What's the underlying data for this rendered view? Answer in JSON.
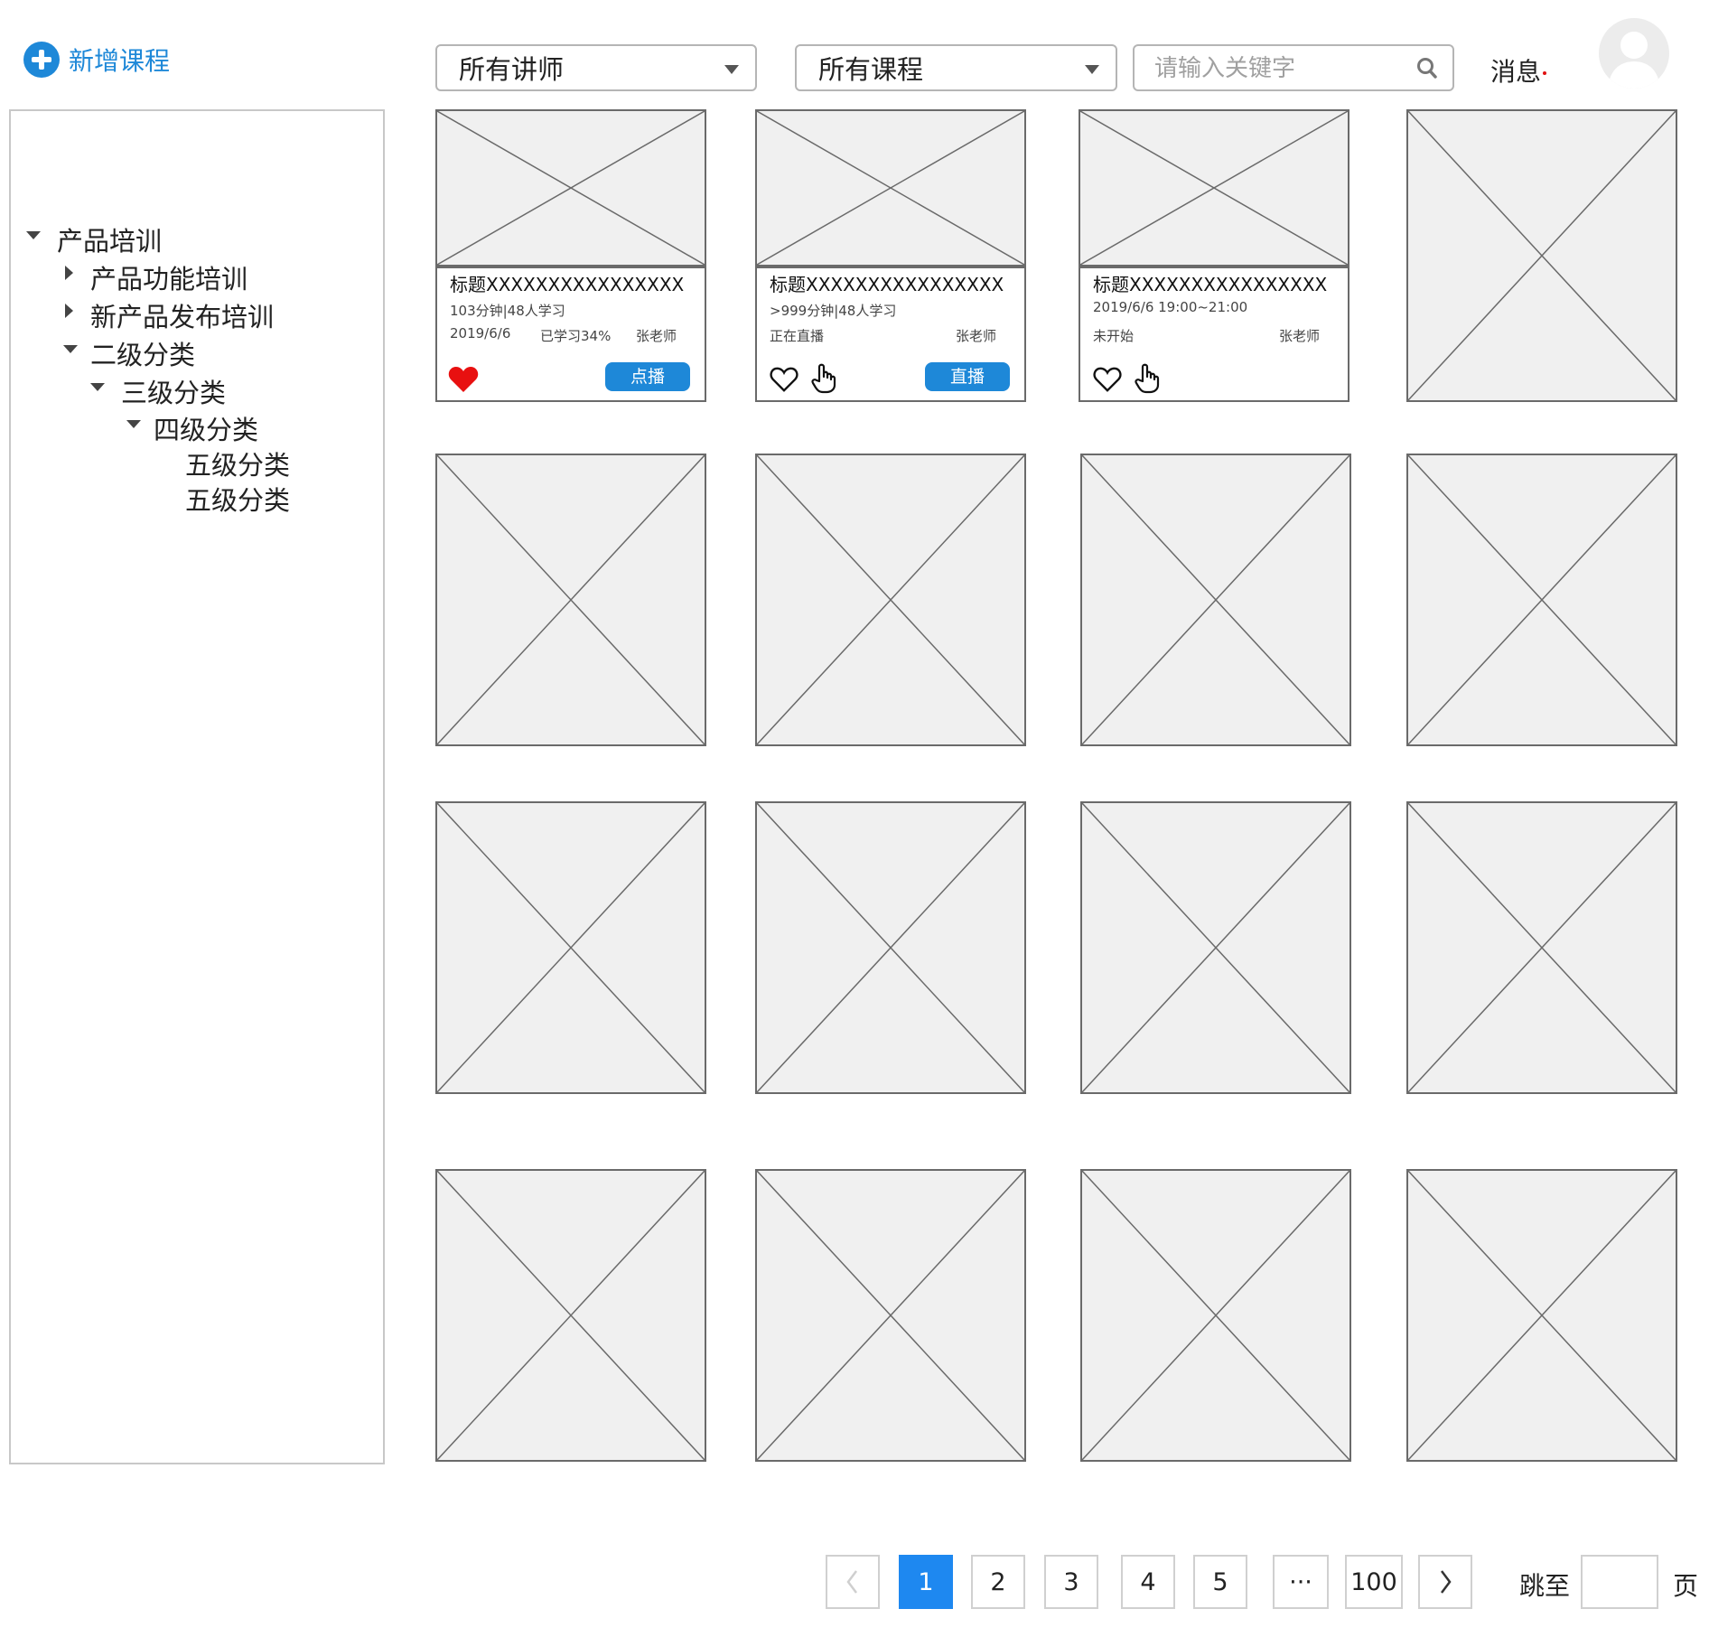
{
  "header": {
    "add_course_label": "新增课程",
    "teacher_select": "所有讲师",
    "course_select": "所有课程",
    "search_placeholder": "请输入关键字",
    "messages_label": "消息"
  },
  "sidebar": {
    "items": [
      {
        "label": "产品培训",
        "expanded": true
      },
      {
        "label": "产品功能培训",
        "expanded": false
      },
      {
        "label": "新产品发布培训",
        "expanded": false
      },
      {
        "label": "二级分类",
        "expanded": true
      },
      {
        "label": "三级分类",
        "expanded": true
      },
      {
        "label": "四级分类",
        "expanded": true
      },
      {
        "label": "五级分类"
      },
      {
        "label": "五级分类"
      }
    ]
  },
  "courses": [
    {
      "title": "标题XXXXXXXXXXXXXXXX",
      "line1": "103分钟|48人学习",
      "date": "2019/6/6",
      "status": "已学习34%",
      "teacher": "张老师",
      "button": "点播",
      "favorited": true
    },
    {
      "title": "标题XXXXXXXXXXXXXXXX",
      "line1": ">999分钟|48人学习",
      "status": "正在直播",
      "teacher": "张老师",
      "button": "直播",
      "favorited": false
    },
    {
      "title": "标题XXXXXXXXXXXXXXXX",
      "line1": "2019/6/6   19:00~21:00",
      "status": "未开始",
      "teacher": "张老师",
      "favorited": false
    }
  ],
  "pagination": {
    "pages": [
      "1",
      "2",
      "3",
      "4",
      "5",
      "···",
      "100"
    ],
    "current": "1",
    "jump_label": "跳至",
    "page_suffix": "页"
  },
  "colors": {
    "accent": "#1e88d8",
    "active_page": "#1e88f0",
    "favorite": "#e81010",
    "placeholder_fill": "#f0f0f0",
    "border": "#6a6a6a"
  },
  "icons": {
    "add": "plus-circle-icon",
    "dropdown": "caret-down-icon",
    "search": "search-icon",
    "avatar": "user-avatar-icon",
    "favorite": "heart-icon",
    "like": "hand-pointer-icon",
    "prev": "chevron-left-icon",
    "next": "chevron-right-icon"
  }
}
